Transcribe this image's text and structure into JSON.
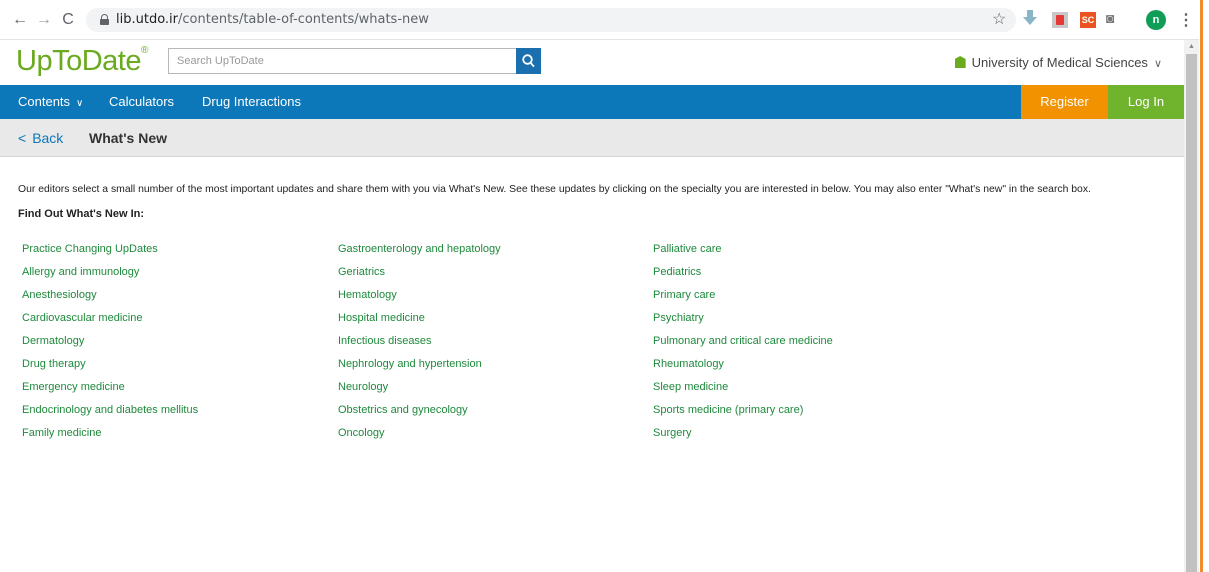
{
  "browser": {
    "url_host": "lib.utdo.ir",
    "url_path": "/contents/table-of-contents/whats-new",
    "profile_initial": "n",
    "sc_label": "SC"
  },
  "header": {
    "logo_text": "UpToDate",
    "logo_mark": "®",
    "search_placeholder": "Search UpToDate",
    "institution": "University of Medical Sciences"
  },
  "nav": {
    "contents": "Contents",
    "calculators": "Calculators",
    "drug_interactions": "Drug Interactions",
    "register": "Register",
    "login": "Log In"
  },
  "breadcrumb": {
    "back": "Back",
    "title": "What's New"
  },
  "content": {
    "intro": "Our editors select a small number of the most important updates and share them with you via What's New. See these updates by clicking on the specialty you are interested in below. You may also enter \"What's new\" in the search box.",
    "heading": "Find Out What's New In:",
    "columns": [
      [
        "Practice Changing UpDates",
        "Allergy and immunology",
        "Anesthesiology",
        "Cardiovascular medicine",
        "Dermatology",
        "Drug therapy",
        "Emergency medicine",
        "Endocrinology and diabetes mellitus",
        "Family medicine"
      ],
      [
        "Gastroenterology and hepatology",
        "Geriatrics",
        "Hematology",
        "Hospital medicine",
        "Infectious diseases",
        "Nephrology and hypertension",
        "Neurology",
        "Obstetrics and gynecology",
        "Oncology"
      ],
      [
        "Palliative care",
        "Pediatrics",
        "Primary care",
        "Psychiatry",
        "Pulmonary and critical care medicine",
        "Rheumatology",
        "Sleep medicine",
        "Sports medicine (primary care)",
        "Surgery"
      ]
    ]
  },
  "icons": {
    "back_arrow": "arrow-left-icon",
    "forward_arrow": "arrow-right-icon",
    "reload": "reload-icon",
    "lock": "lock-icon",
    "star": "star-icon",
    "search": "search-icon"
  },
  "colors": {
    "brand_green": "#6aaa1e",
    "nav_blue": "#0c77b9",
    "register_orange": "#f29200",
    "login_green": "#6fb42c",
    "link_green": "#1e8a3c"
  }
}
